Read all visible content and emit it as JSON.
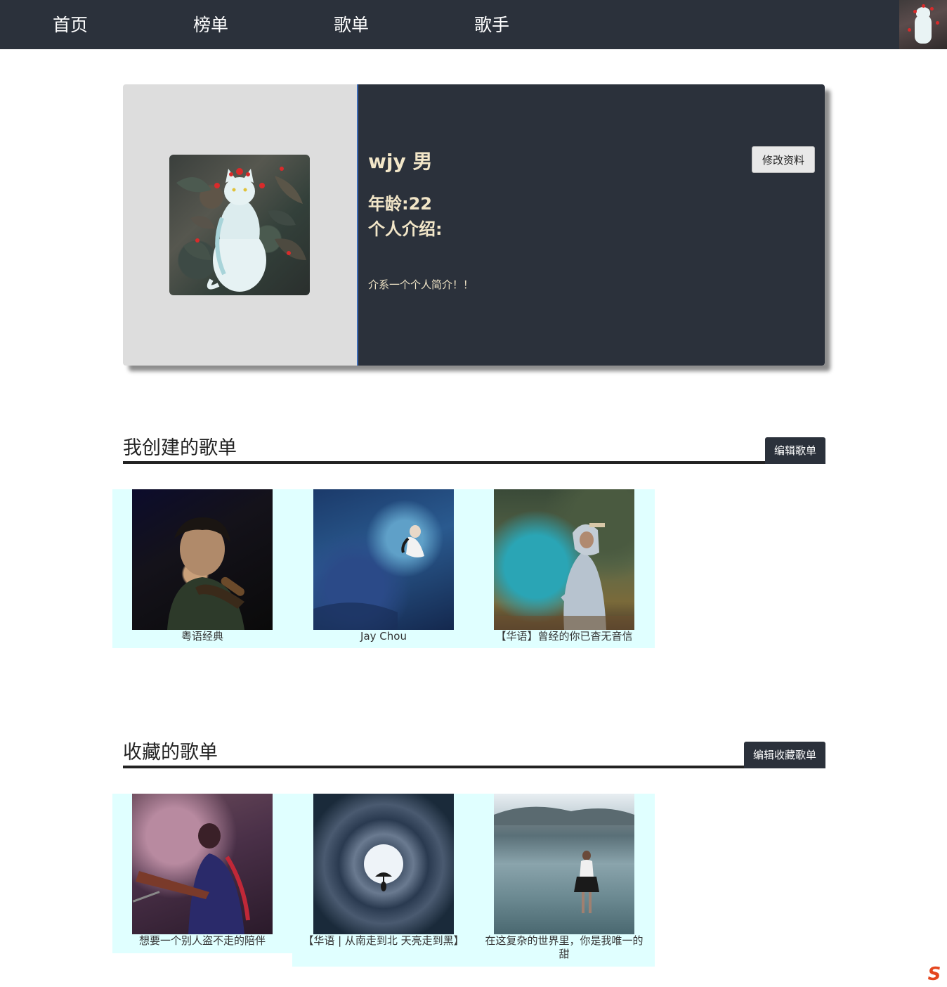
{
  "nav": {
    "items": [
      {
        "label": "首页"
      },
      {
        "label": "榜单"
      },
      {
        "label": "歌单"
      },
      {
        "label": "歌手"
      }
    ]
  },
  "profile": {
    "name": "wjy 男",
    "age": "年龄:22",
    "intro_label": "个人介绍:",
    "intro": "介系一个个人简介！！",
    "edit_button": "修改资料"
  },
  "created": {
    "title": "我创建的歌单",
    "edit_button": "编辑歌单",
    "playlists": [
      {
        "name": "粤语经典",
        "cover": "singer-on-stage"
      },
      {
        "name": "Jay Chou",
        "cover": "blue-mist-figure"
      },
      {
        "name": "【华语】曾经的你已杳无音信",
        "cover": "smoke-hoodie-man"
      }
    ]
  },
  "collected": {
    "title": "收藏的歌单",
    "edit_button": "编辑收藏歌单",
    "playlists": [
      {
        "name": "想要一个别人盗不走的陪伴",
        "cover": "guitarist-purple"
      },
      {
        "name": "【华语 | 从南走到北 天亮走到黑】",
        "cover": "tunnel-umbrella"
      },
      {
        "name": "在这复杂的世界里，你是我唯一的甜",
        "cover": "girl-in-lake"
      }
    ]
  },
  "colors": {
    "nav_bg": "#2b313b",
    "card_text": "#f2e6c8",
    "grid_bg": "#e0ffff",
    "ime_logo": "#e4461f"
  }
}
